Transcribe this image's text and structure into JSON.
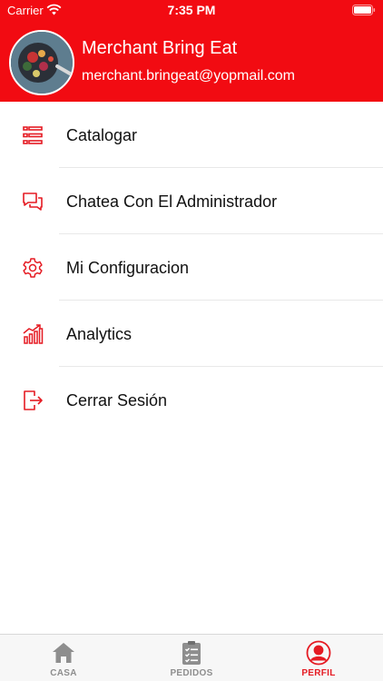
{
  "status_bar": {
    "carrier": "Carrier",
    "time": "7:35 PM"
  },
  "profile": {
    "name": "Merchant Bring Eat",
    "email": "merchant.bringeat@yopmail.com"
  },
  "menu": {
    "items": [
      {
        "label": "Catalogar",
        "icon": "list-icon"
      },
      {
        "label": "Chatea Con El Administrador",
        "icon": "chat-icon"
      },
      {
        "label": "Mi Configuracion",
        "icon": "gear-icon"
      },
      {
        "label": "Analytics",
        "icon": "chart-icon"
      },
      {
        "label": "Cerrar Sesión",
        "icon": "logout-icon"
      }
    ]
  },
  "tabs": [
    {
      "label": "CASA",
      "icon": "home-icon",
      "active": false
    },
    {
      "label": "PEDIDOS",
      "icon": "clipboard-icon",
      "active": false
    },
    {
      "label": "PERFIL",
      "icon": "user-icon",
      "active": true
    }
  ],
  "colors": {
    "brand": "#f20b12",
    "accent": "#e51b23",
    "inactive": "#8e8e8e"
  }
}
